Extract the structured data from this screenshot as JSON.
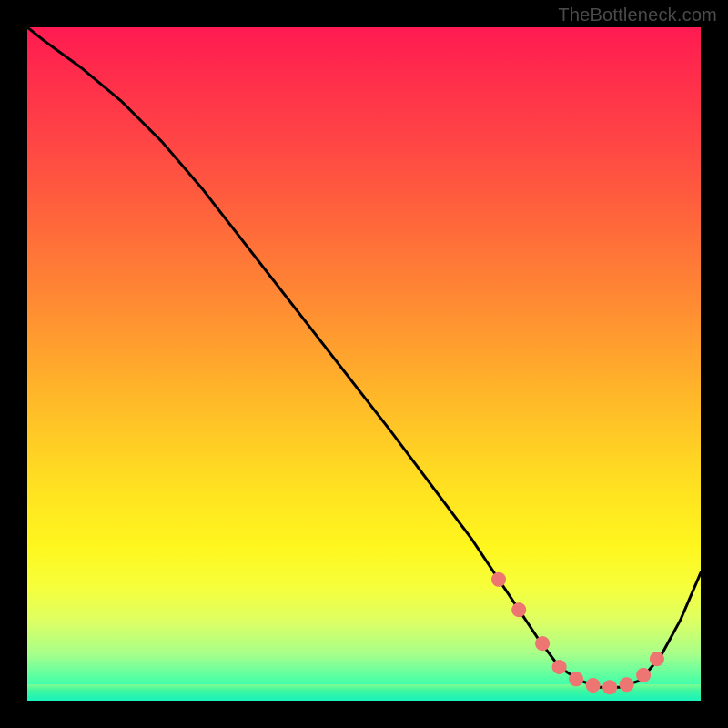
{
  "watermark": "TheBottleneck.com",
  "colors": {
    "marker": "#ed7572",
    "curve": "#000000"
  },
  "chart_data": {
    "type": "line",
    "title": "",
    "xlabel": "",
    "ylabel": "",
    "xlim": [
      0,
      100
    ],
    "ylim": [
      0,
      100
    ],
    "grid": false,
    "legend": false,
    "series": [
      {
        "name": "bottleneck-curve",
        "x": [
          0,
          2.5,
          8,
          14,
          20,
          26,
          33,
          40,
          47,
          54,
          60,
          66,
          70,
          73,
          76,
          79,
          82,
          85,
          88,
          91,
          94,
          97,
          100
        ],
        "y": [
          100,
          98,
          94,
          89,
          83,
          76,
          67,
          58,
          49,
          40,
          32,
          24,
          18,
          13.5,
          9,
          5,
          3,
          2,
          2,
          3,
          6.5,
          12,
          19
        ]
      }
    ],
    "markers": {
      "name": "highlighted-points",
      "x": [
        70,
        73,
        76.5,
        79,
        81.5,
        84,
        86.5,
        89,
        91.5,
        93.5
      ],
      "y": [
        18,
        13.5,
        8.5,
        5,
        3.2,
        2.3,
        2.0,
        2.4,
        3.8,
        6.2
      ]
    }
  }
}
